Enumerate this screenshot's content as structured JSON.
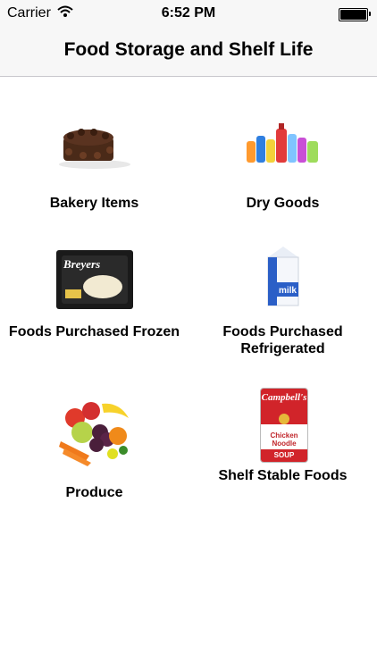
{
  "status_bar": {
    "carrier": "Carrier",
    "time": "6:52 PM"
  },
  "nav": {
    "title": "Food Storage and Shelf Life"
  },
  "categories": [
    {
      "label": "Bakery Items",
      "icon": "cake-icon"
    },
    {
      "label": "Dry Goods",
      "icon": "bottles-icon"
    },
    {
      "label": "Foods Purchased Frozen",
      "icon": "ice-cream-icon"
    },
    {
      "label": "Foods Purchased Refrigerated",
      "icon": "milk-carton-icon"
    },
    {
      "label": "Produce",
      "icon": "produce-icon"
    },
    {
      "label": "Shelf Stable Foods",
      "icon": "soup-can-icon"
    }
  ],
  "images": {
    "ice_cream_brand": "Breyers",
    "milk_word": "milk",
    "soup_brand": "Campbell's",
    "soup_name_line1": "Chicken",
    "soup_name_line2": "Noodle",
    "soup_word": "SOUP"
  },
  "colors": {
    "bar_bg": "#f7f7f7",
    "separator": "#c8c7cc"
  }
}
